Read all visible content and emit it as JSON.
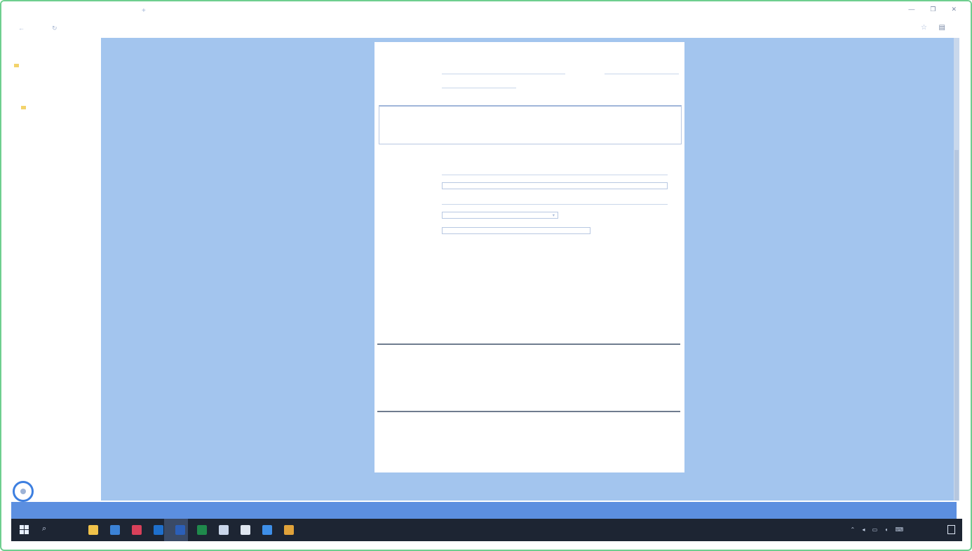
{
  "browser": {
    "tab_title": "",
    "new_tab": "+",
    "url": "",
    "window_controls": [
      "—",
      "❐",
      "✕"
    ]
  },
  "sidebar": {
    "items": [
      {
        "label": "",
        "indent": 1
      },
      {
        "label": "",
        "indent": 1
      },
      {
        "label": "",
        "indent": 0,
        "folder": true
      },
      {
        "label": "",
        "indent": 1
      },
      {
        "label": "",
        "indent": 1
      },
      {
        "label": "",
        "indent": 1
      },
      {
        "label": "",
        "indent": 0,
        "folder": true
      }
    ],
    "help_label": ""
  },
  "form": {
    "section_general": "",
    "fields": {
      "title_label": "",
      "title_value": "",
      "dept_label": "",
      "dept_value": "",
      "amount_label": "",
      "amount_value": "",
      "status_label": "",
      "status_value": "",
      "description_label": ""
    },
    "section_address": "",
    "address": {
      "line1_label": "",
      "line1_value": "",
      "line2_label": "",
      "line3_label": "",
      "unit_label": "",
      "unit_value": "",
      "extra_label": ""
    },
    "section_contacts": "",
    "contacts": {
      "headers": [
        "",
        "",
        ""
      ],
      "rows": [
        [
          "",
          "",
          ""
        ],
        [
          "",
          "",
          ""
        ]
      ]
    },
    "section_items": "",
    "items": {
      "headers": [
        "",
        "",
        "",
        "",
        "",
        "",
        ""
      ],
      "row": [
        "",
        "",
        "",
        "",
        "",
        ""
      ]
    },
    "section_history": "",
    "history": {
      "headers": [
        "",
        "",
        "",
        "",
        "",
        ""
      ],
      "rows": [
        [
          "",
          "",
          "",
          "",
          "",
          ""
        ],
        [
          "",
          "",
          "",
          "",
          "",
          ""
        ]
      ]
    }
  },
  "statusbar": {
    "text": ""
  },
  "taskbar": {
    "clock_time": "",
    "clock_date": "",
    "apps": [
      {
        "name": "file-explorer-icon",
        "color": "#f0c24a"
      },
      {
        "name": "store-icon",
        "color": "#3b82d6"
      },
      {
        "name": "calendar-icon",
        "color": "#d8405a"
      },
      {
        "name": "outlook-icon",
        "color": "#1e6fcc"
      },
      {
        "name": "word-icon",
        "color": "#2b5fb8"
      },
      {
        "name": "excel-icon",
        "color": "#1f8a4c"
      },
      {
        "name": "photos-icon",
        "color": "#c9d6ea"
      },
      {
        "name": "calculator-icon",
        "color": "#dfe6f0"
      },
      {
        "name": "remote-icon",
        "color": "#3e8fe8"
      },
      {
        "name": "chrome-icon",
        "color": "#e0a23a"
      }
    ]
  }
}
